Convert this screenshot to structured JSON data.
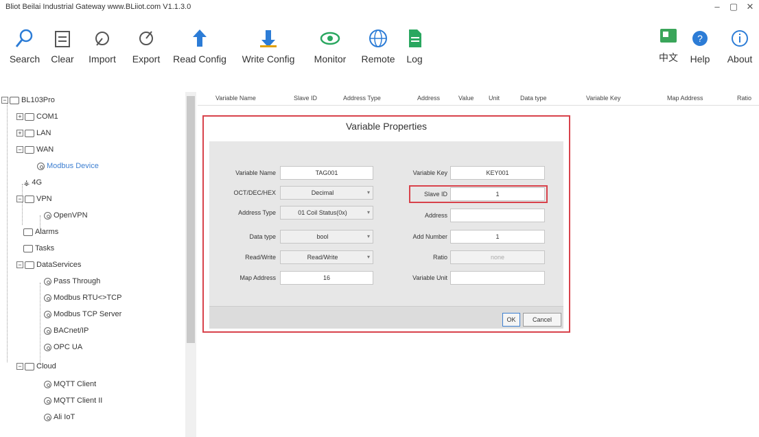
{
  "window": {
    "title": "Bliot Beilai Industrial Gateway www.BLiiot.com V1.1.3.0",
    "controls": [
      "–",
      "▢",
      "✕"
    ]
  },
  "toolbar": {
    "search": "Search",
    "clear": "Clear",
    "import": "Import",
    "export": "Export",
    "read_config": "Read Config",
    "write_config": "Write Config",
    "monitor": "Monitor",
    "remote": "Remote",
    "log": "Log",
    "language": "中文",
    "help": "Help",
    "about": "About"
  },
  "tree": {
    "root": "BL103Pro",
    "com1": "COM1",
    "lan": "LAN",
    "wan": "WAN",
    "wan_child": "Modbus Device",
    "g4": "4G",
    "vpn": "VPN",
    "openvpn": "OpenVPN",
    "alarms": "Alarms",
    "tasks": "Tasks",
    "dataservices": "DataServices",
    "pass_through": "Pass Through",
    "modbus_rtu_tcp": "Modbus RTU<>TCP",
    "modbus_tcp_server": "Modbus TCP Server",
    "bacnet": "BACnet/IP",
    "opc_ua": "OPC UA",
    "cloud": "Cloud",
    "mqtt_client": "MQTT Client",
    "mqtt_client2": "MQTT Client II",
    "ali_iot": "Ali IoT"
  },
  "columns": [
    "Variable Name",
    "Slave ID",
    "Address Type",
    "Address",
    "Value",
    "Unit",
    "Data type",
    "Variable Key",
    "Map Address",
    "Ratio"
  ],
  "dialog": {
    "title": "Variable Properties",
    "labels": {
      "variable_name": "Variable Name",
      "oct_dec_hex": "OCT/DEC/HEX",
      "address_type": "Address Type",
      "data_type": "Data type",
      "read_write": "Read/Write",
      "map_address": "Map Address",
      "variable_key": "Variable Key",
      "slave_id": "Slave ID",
      "address": "Address",
      "add_number": "Add Number",
      "ratio": "Ratio",
      "variable_unit": "Variable Unit"
    },
    "values": {
      "variable_name": "TAG001",
      "oct_dec_hex": "Decimal",
      "address_type": "01 Coil Status(0x)",
      "data_type": "bool",
      "read_write": "Read/Write",
      "map_address": "16",
      "variable_key": "KEY001",
      "slave_id": "1",
      "address": "",
      "add_number": "1",
      "ratio": "none",
      "variable_unit": ""
    },
    "ok": "OK",
    "cancel": "Cancel"
  }
}
